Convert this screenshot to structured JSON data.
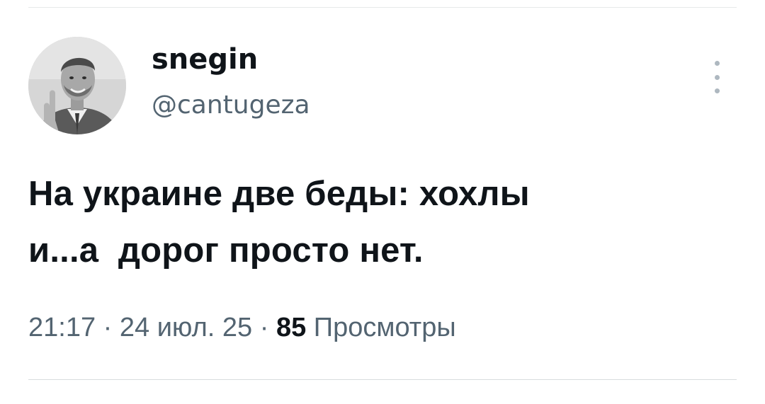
{
  "author": {
    "display_name": "snegin",
    "handle": "@cantugeza"
  },
  "tweet": {
    "line1": "На украине две беды: хохлы",
    "line2": "и...а  дорог просто нет."
  },
  "meta": {
    "time": "21:17",
    "separator1": " · ",
    "date": "24 июл. 25",
    "separator2": " · ",
    "views_count": "85",
    "views_label": "Просмотры"
  },
  "icons": {
    "more": "more-vertical-icon"
  },
  "colors": {
    "text_primary": "#0f1419",
    "text_secondary": "#536471",
    "divider": "#e7e9ea"
  }
}
